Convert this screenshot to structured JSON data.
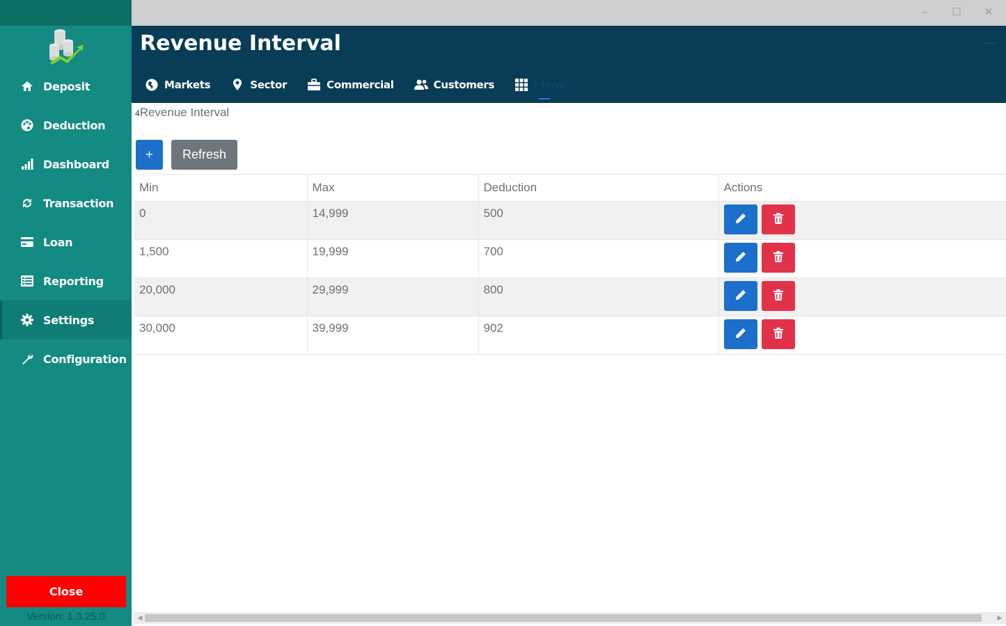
{
  "window": {
    "minimize": "–",
    "maximize": "☐",
    "close": "✕"
  },
  "sidebar": {
    "items": [
      {
        "label": "Deposit",
        "icon": "home-icon"
      },
      {
        "label": "Deduction",
        "icon": "palette-icon"
      },
      {
        "label": "Dashboard",
        "icon": "bar-chart-icon"
      },
      {
        "label": "Transaction",
        "icon": "exchange-icon"
      },
      {
        "label": "Loan",
        "icon": "card-icon"
      },
      {
        "label": "Reporting",
        "icon": "list-icon"
      },
      {
        "label": "Settings",
        "icon": "gear-icon"
      },
      {
        "label": "Configuration",
        "icon": "wrench-icon"
      }
    ],
    "active": "Settings",
    "close_label": "Close",
    "version": "Version: 1.3.25.0"
  },
  "header": {
    "title": "Revenue Interval",
    "more": "...",
    "tabs": [
      {
        "label": "Markets",
        "icon": "globe-icon"
      },
      {
        "label": "Sector",
        "icon": "map-pin-icon"
      },
      {
        "label": "Commercial",
        "icon": "briefcase-icon"
      },
      {
        "label": "Customers",
        "icon": "users-icon"
      },
      {
        "label": "Interval",
        "icon": "grid-icon"
      }
    ],
    "active_tab": "Interval"
  },
  "breadcrumb": {
    "caret": "4",
    "text": "Revenue Interval"
  },
  "toolbar": {
    "add_label": "+",
    "refresh_label": "Refresh"
  },
  "table": {
    "columns": [
      "Min",
      "Max",
      "Deduction",
      "Actions"
    ],
    "rows": [
      {
        "min": "0",
        "max": "14,999",
        "deduction": "500"
      },
      {
        "min": "1,500",
        "max": "19,999",
        "deduction": "700"
      },
      {
        "min": "20,000",
        "max": "29,999",
        "deduction": "800"
      },
      {
        "min": "30,000",
        "max": "39,999",
        "deduction": "902"
      }
    ]
  },
  "colors": {
    "sidebar": "#138a82",
    "header": "#083c57",
    "primary": "#1d6fcc",
    "danger": "#e0334a",
    "close": "#ff0000"
  }
}
